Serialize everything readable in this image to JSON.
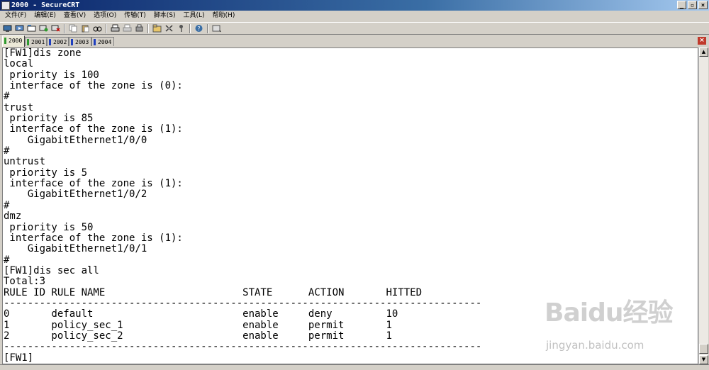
{
  "window": {
    "title": "2000 - SecureCRT",
    "controls": [
      "_",
      "▫",
      "×"
    ]
  },
  "menu": [
    "文件(F)",
    "编辑(E)",
    "查看(V)",
    "选项(O)",
    "传输(T)",
    "脚本(S)",
    "工具(L)",
    "帮助(H)"
  ],
  "tabs": [
    {
      "label": "2000",
      "color": "#2e9a2e",
      "active": true
    },
    {
      "label": "2001",
      "color": "#2e9a2e"
    },
    {
      "label": "2002",
      "color": "#1f3fbf"
    },
    {
      "label": "2003",
      "color": "#1f3fbf"
    },
    {
      "label": "2004",
      "color": "#1f3fbf"
    }
  ],
  "tab_close": "×",
  "terminal": {
    "lines": [
      "[FW1]dis zone",
      "local",
      " priority is 100",
      " interface of the zone is (0):",
      "#",
      "trust",
      " priority is 85",
      " interface of the zone is (1):",
      "    GigabitEthernet1/0/0",
      "#",
      "untrust",
      " priority is 5",
      " interface of the zone is (1):",
      "    GigabitEthernet1/0/2",
      "#",
      "dmz",
      " priority is 50",
      " interface of the zone is (1):",
      "    GigabitEthernet1/0/1",
      "#",
      "[FW1]dis sec all",
      "Total:3",
      "RULE ID RULE NAME                       STATE      ACTION       HITTED",
      "--------------------------------------------------------------------------------",
      "0       default                         enable     deny         10",
      "1       policy_sec_1                    enable     permit       1",
      "2       policy_sec_2                    enable     permit       1",
      "--------------------------------------------------------------------------------",
      "[FW1]"
    ]
  },
  "watermark": {
    "logo": "Baidu经验",
    "url": "jingyan.baidu.com"
  },
  "scroll": {
    "up": "▲",
    "down": "▼"
  }
}
